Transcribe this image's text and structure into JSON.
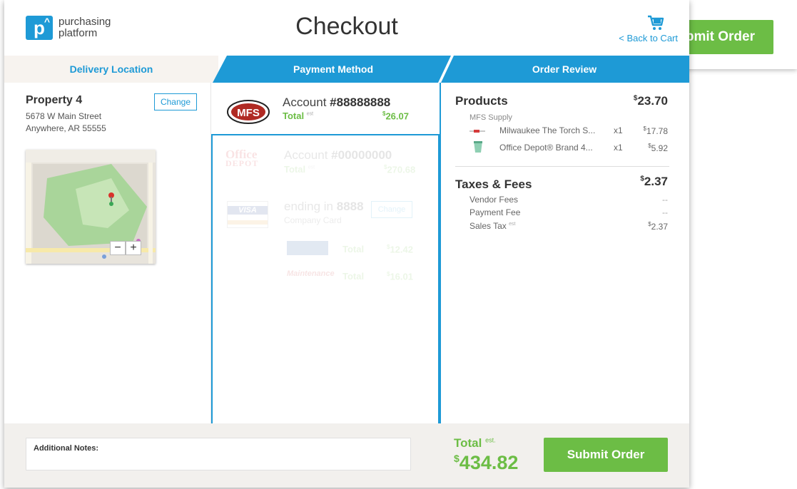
{
  "background_page": {
    "submit_label": "Submit Order"
  },
  "header": {
    "logo_mark": "p",
    "logo_line1": "purchasing",
    "logo_line2": "platform",
    "title": "Checkout",
    "back_to_cart": "< Back to Cart"
  },
  "tabs": {
    "delivery": "Delivery Location",
    "payment": "Payment Method",
    "review": "Order Review"
  },
  "delivery": {
    "property_name": "Property 4",
    "address_line1": "5678 W Main Street",
    "address_line2": "Anywhere, AR   55555",
    "change_label": "Change",
    "map_zoom_out": "−",
    "map_zoom_in": "+"
  },
  "payment": {
    "selected": {
      "account_label": "Account",
      "account_number": "#88888888",
      "total_label": "Total",
      "total_est": "est",
      "total_value": "26.07",
      "currency": "$",
      "logo_text": "MFS"
    },
    "office_depot": {
      "logo_line1": "Office",
      "logo_line2": "DEPOT",
      "account_label": "Account",
      "account_number": "#00000000",
      "total_label": "Total",
      "total_est": "est",
      "total_value": "270.68",
      "currency": "$"
    },
    "card": {
      "logo_text": "VISA",
      "ending_label": "ending in",
      "ending_digits": "8888",
      "card_type": "Company Card",
      "change_label": "Change",
      "sub1_total_label": "Total",
      "sub1_total_value": "12.42",
      "sub2_logo": "Maintenance",
      "sub2_total_label": "Total",
      "sub2_total_value": "16.01",
      "currency": "$"
    }
  },
  "review": {
    "products_label": "Products",
    "products_total": "23.70",
    "vendor": "MFS Supply",
    "items": [
      {
        "name": "Milwaukee The Torch S...",
        "qty": "x1",
        "price": "17.78"
      },
      {
        "name": "Office Depot® Brand 4...",
        "qty": "x1",
        "price": "5.92"
      }
    ],
    "taxes_label": "Taxes & Fees",
    "taxes_total": "2.37",
    "vendor_fees_label": "Vendor Fees",
    "vendor_fees_value": "--",
    "payment_fee_label": "Payment Fee",
    "payment_fee_value": "--",
    "sales_tax_label": "Sales Tax",
    "sales_tax_est": "est",
    "sales_tax_value": "2.37",
    "currency": "$"
  },
  "footer": {
    "notes_label": "Additional Notes:",
    "total_label": "Total",
    "total_est": "est.",
    "total_value": "434.82",
    "currency": "$",
    "submit_label": "Submit Order"
  },
  "colors": {
    "accent_blue": "#1e9ad6",
    "accent_green": "#6cbd45"
  }
}
